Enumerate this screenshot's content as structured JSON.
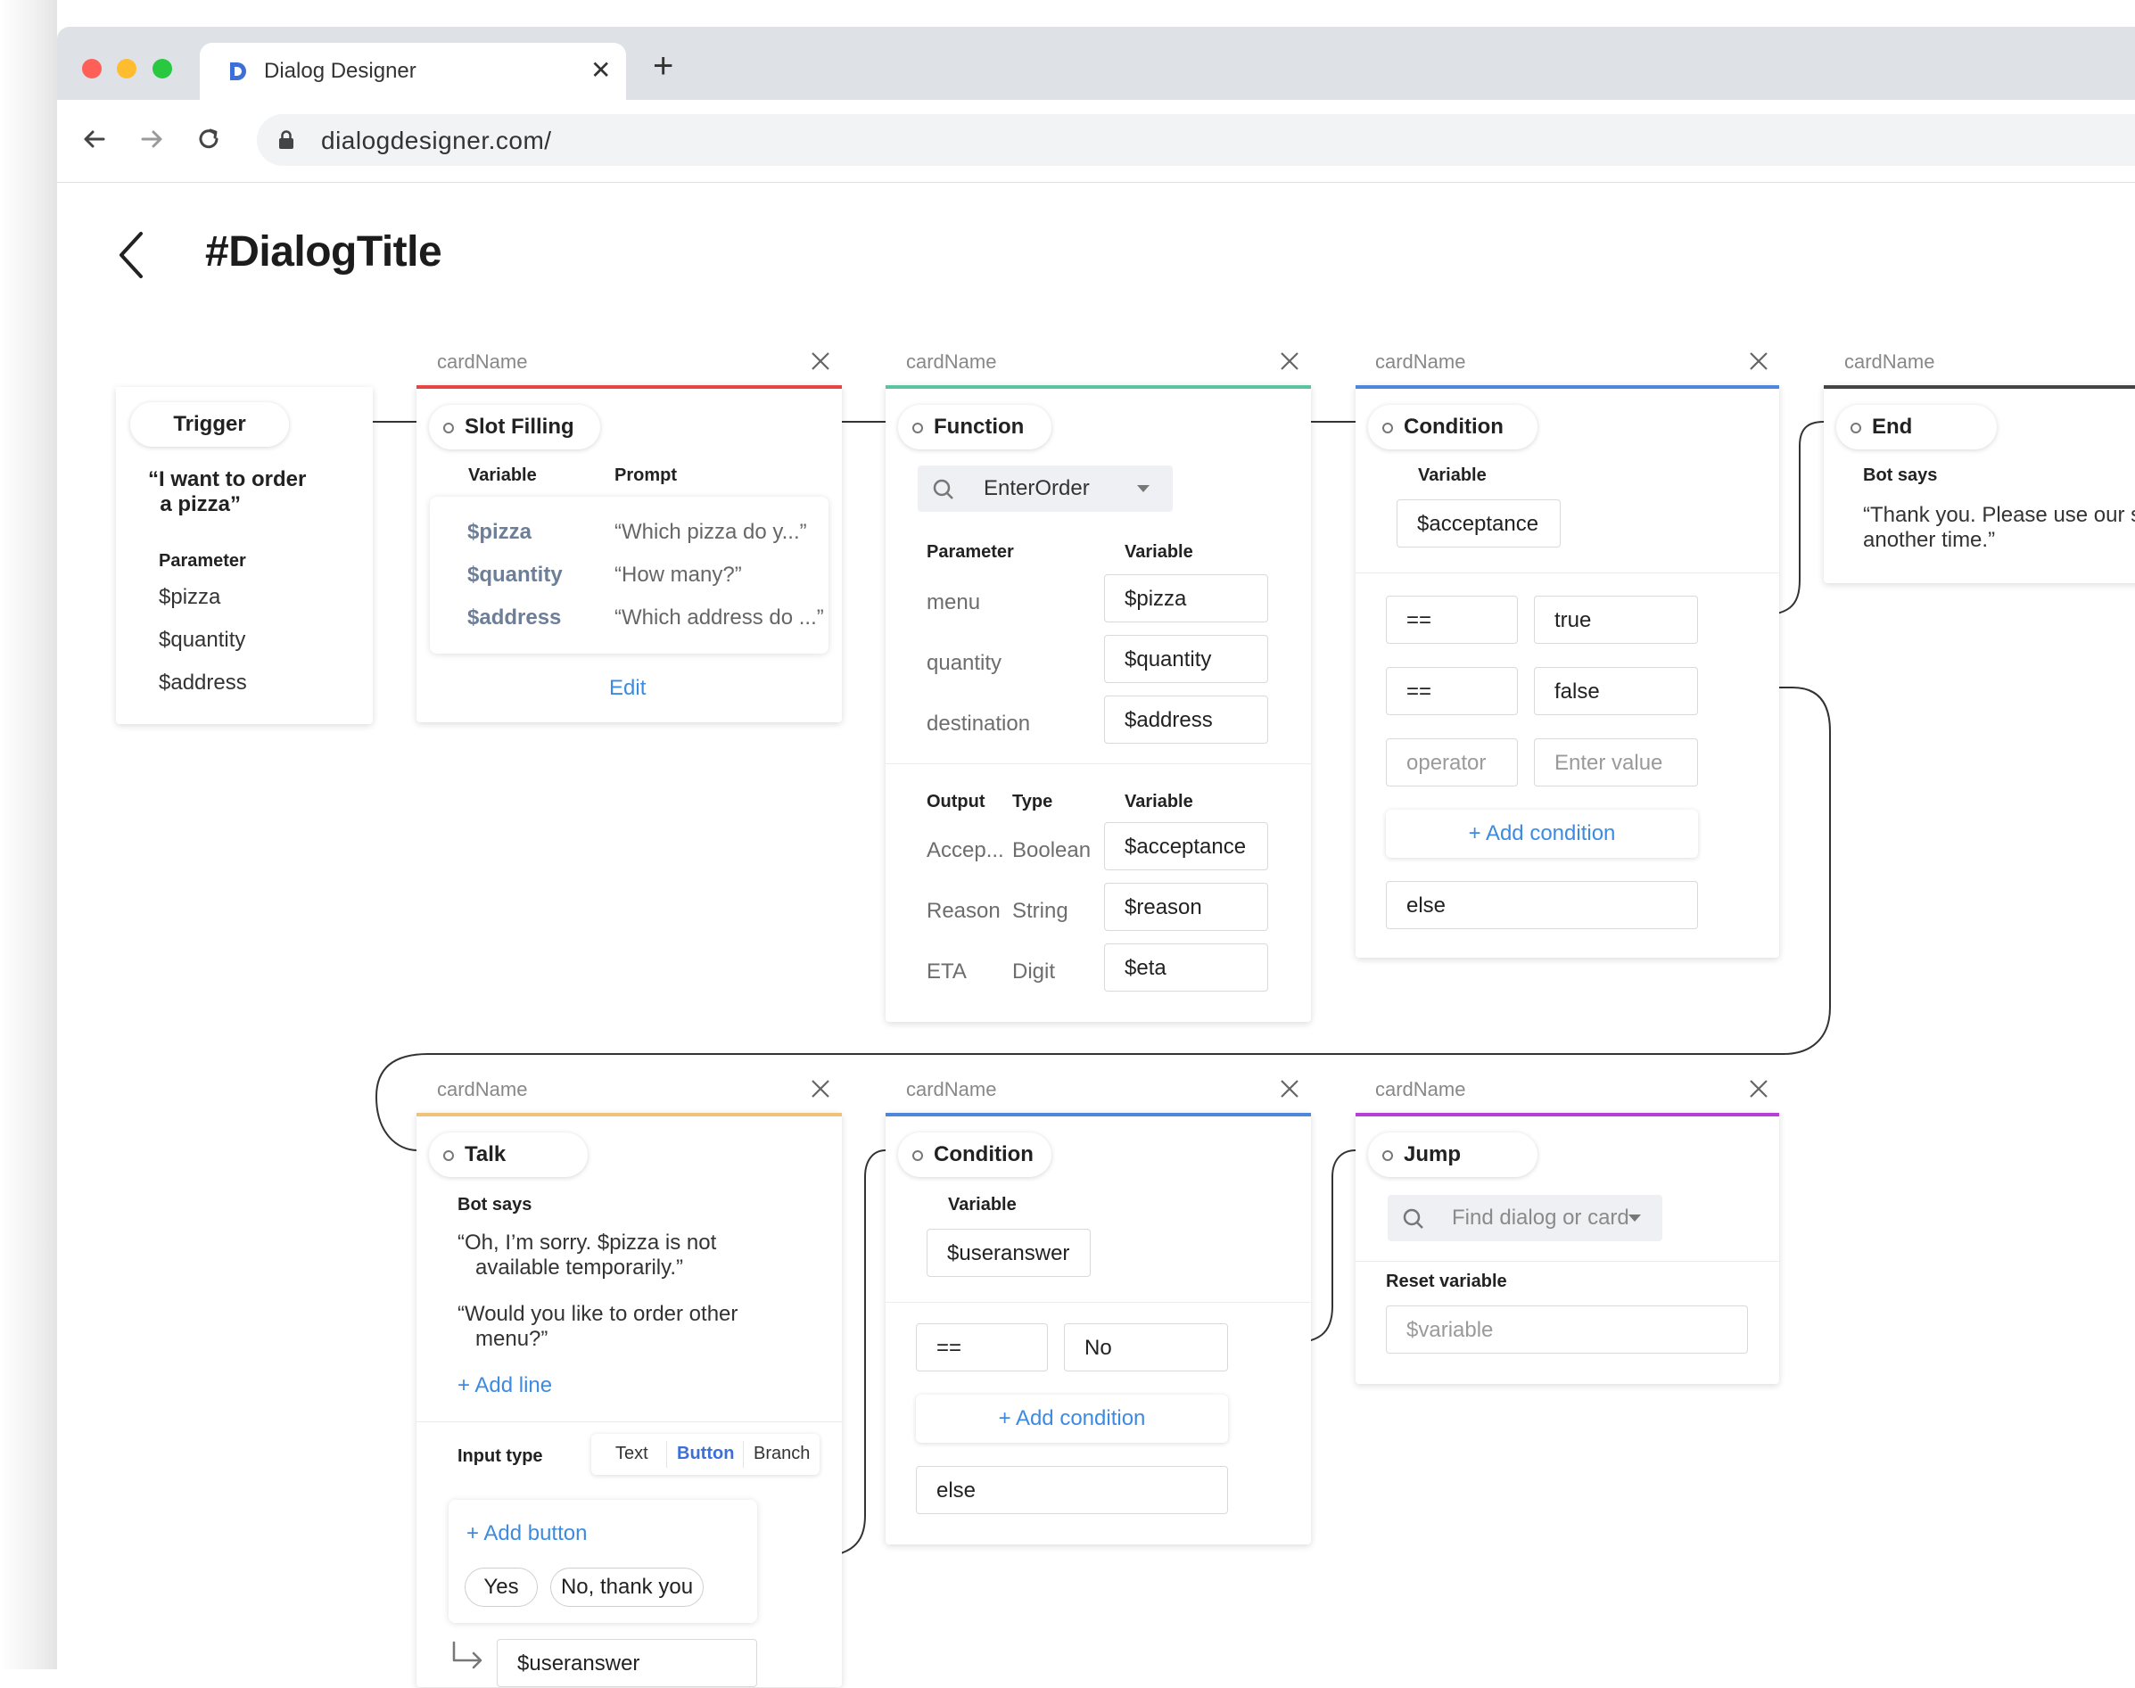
{
  "browser": {
    "tab_title": "Dialog Designer",
    "url": "dialogdesigner.com/"
  },
  "page": {
    "title": "#DialogTitle"
  },
  "colors": {
    "slot_filling": "#e64545",
    "function": "#5dc2a2",
    "condition": "#4f86db",
    "end": "#444444",
    "talk": "#f1c27a",
    "jump": "#b540d6",
    "link": "#3d8be0"
  },
  "trigger": {
    "pill": "Trigger",
    "utterance": "“I want to order\n  a pizza”",
    "param_label": "Parameter",
    "params": [
      "$pizza",
      "$quantity",
      "$address"
    ]
  },
  "slot_filling": {
    "card_name": "cardName",
    "pill": "Slot Filling",
    "col_variable": "Variable",
    "col_prompt": "Prompt",
    "rows": [
      {
        "variable": "$pizza",
        "prompt": "“Which pizza do y...”"
      },
      {
        "variable": "$quantity",
        "prompt": "“How many?”"
      },
      {
        "variable": "$address",
        "prompt": "“Which address do ...”"
      }
    ],
    "edit": "Edit"
  },
  "function": {
    "card_name": "cardName",
    "pill": "Function",
    "selected": "EnterOrder",
    "col_parameter": "Parameter",
    "col_variable": "Variable",
    "params": [
      {
        "name": "menu",
        "variable": "$pizza"
      },
      {
        "name": "quantity",
        "variable": "$quantity"
      },
      {
        "name": "destination",
        "variable": "$address"
      }
    ],
    "col_output": "Output",
    "col_type": "Type",
    "col_variable2": "Variable",
    "outputs": [
      {
        "name": "Accep...",
        "type": "Boolean",
        "variable": "$acceptance"
      },
      {
        "name": "Reason",
        "type": "String",
        "variable": "$reason"
      },
      {
        "name": "ETA",
        "type": "Digit",
        "variable": "$eta"
      }
    ]
  },
  "condition1": {
    "card_name": "cardName",
    "pill": "Condition",
    "variable_label": "Variable",
    "variable": "$acceptance",
    "rows": [
      {
        "op": "==",
        "value": "true"
      },
      {
        "op": "==",
        "value": "false"
      }
    ],
    "op_placeholder": "operator",
    "value_placeholder": "Enter value",
    "add_condition": "+ Add condition",
    "else": "else"
  },
  "end": {
    "card_name": "cardName",
    "pill": "End",
    "bot_says_label": "Bot says",
    "message": "“Thank you. Please use our ser\nanother time.”"
  },
  "talk": {
    "card_name": "cardName",
    "pill": "Talk",
    "bot_says_label": "Bot says",
    "line1": "“Oh, I’m sorry. $pizza is not\n   available temporarily.”",
    "line2": "“Would you like to order other\n   menu?”",
    "add_line": "+ Add line",
    "input_type_label": "Input type",
    "input_types": [
      "Text",
      "Button",
      "Branch"
    ],
    "input_type_selected": "Button",
    "add_button": "+ Add button",
    "buttons": [
      "Yes",
      "No, thank you"
    ],
    "output_variable": "$useranswer"
  },
  "condition2": {
    "card_name": "cardName",
    "pill": "Condition",
    "variable_label": "Variable",
    "variable": "$useranswer",
    "rows": [
      {
        "op": "==",
        "value": "No"
      }
    ],
    "add_condition": "+ Add condition",
    "else": "else"
  },
  "jump": {
    "card_name": "cardName",
    "pill": "Jump",
    "search_placeholder": "Find dialog or card",
    "reset_label": "Reset variable",
    "reset_placeholder": "$variable"
  }
}
